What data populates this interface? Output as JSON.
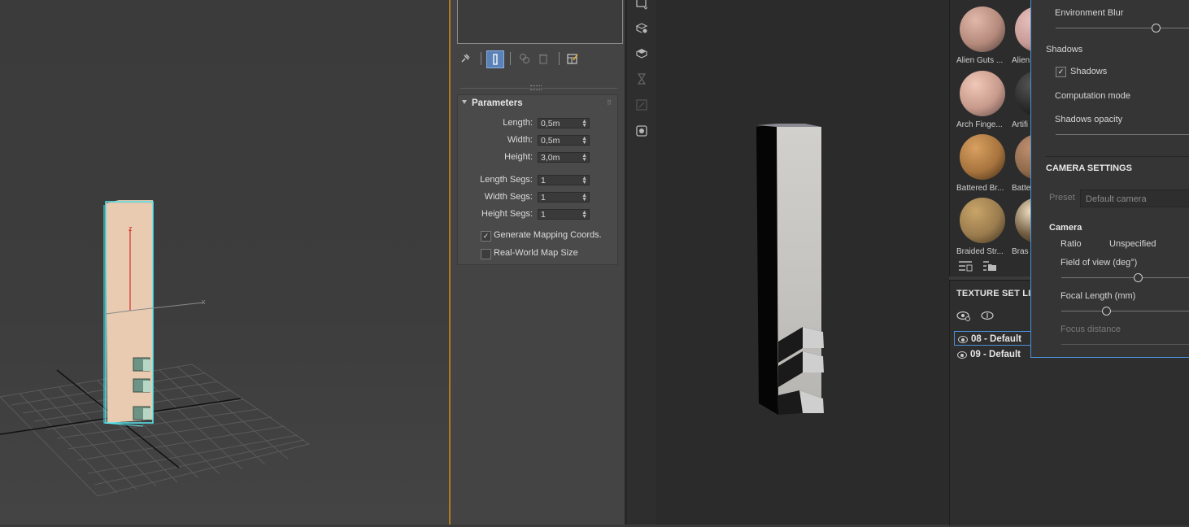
{
  "command_panel": {
    "rollout_title": "Parameters",
    "params": [
      {
        "label": "Length:",
        "value": "0,5m"
      },
      {
        "label": "Width:",
        "value": "0,5m"
      },
      {
        "label": "Height:",
        "value": "3,0m"
      },
      {
        "label": "Length Segs:",
        "value": "1"
      },
      {
        "label": "Width Segs:",
        "value": "1"
      },
      {
        "label": "Height Segs:",
        "value": "1"
      }
    ],
    "checkboxes": [
      {
        "label": "Generate Mapping Coords.",
        "checked": true
      },
      {
        "label": "Real-World Map Size",
        "checked": false
      }
    ]
  },
  "viewport": {
    "axis_z": "z",
    "axis_x": "x"
  },
  "shelf": {
    "materials": [
      {
        "label": "Alien Guts ...",
        "color": "#b58a7c"
      },
      {
        "label": "Alien",
        "color": "#c89a96"
      },
      {
        "label": "Arch Finge...",
        "color": "#c79a8c"
      },
      {
        "label": "Artifi",
        "color": "#2a2a2a"
      },
      {
        "label": "Battered Br...",
        "color": "#a8743e"
      },
      {
        "label": "Batte",
        "color": "#8f6a4c"
      },
      {
        "label": "Braided Str...",
        "color": "#9b7c4e"
      },
      {
        "label": "Bras",
        "color": "#6e5a3e"
      }
    ]
  },
  "texture_set_list": {
    "title": "TEXTURE SET LIS",
    "items": [
      "08 - Default",
      "09 - Default"
    ],
    "selected": "08 - Default"
  },
  "display_settings": {
    "environment_blur": "Environment Blur",
    "shadows_section": "Shadows",
    "shadows_checkbox": "Shadows",
    "computation_mode": "Computation mode",
    "shadows_opacity": "Shadows opacity",
    "camera_settings": "CAMERA SETTINGS",
    "preset_label": "Preset",
    "preset_value": "Default camera",
    "camera_section": "Camera",
    "ratio_label": "Ratio",
    "ratio_value": "Unspecified",
    "fov_label": "Field of view (deg°)",
    "focal_label": "Focal Length (mm)",
    "focus_distance": "Focus distance"
  }
}
